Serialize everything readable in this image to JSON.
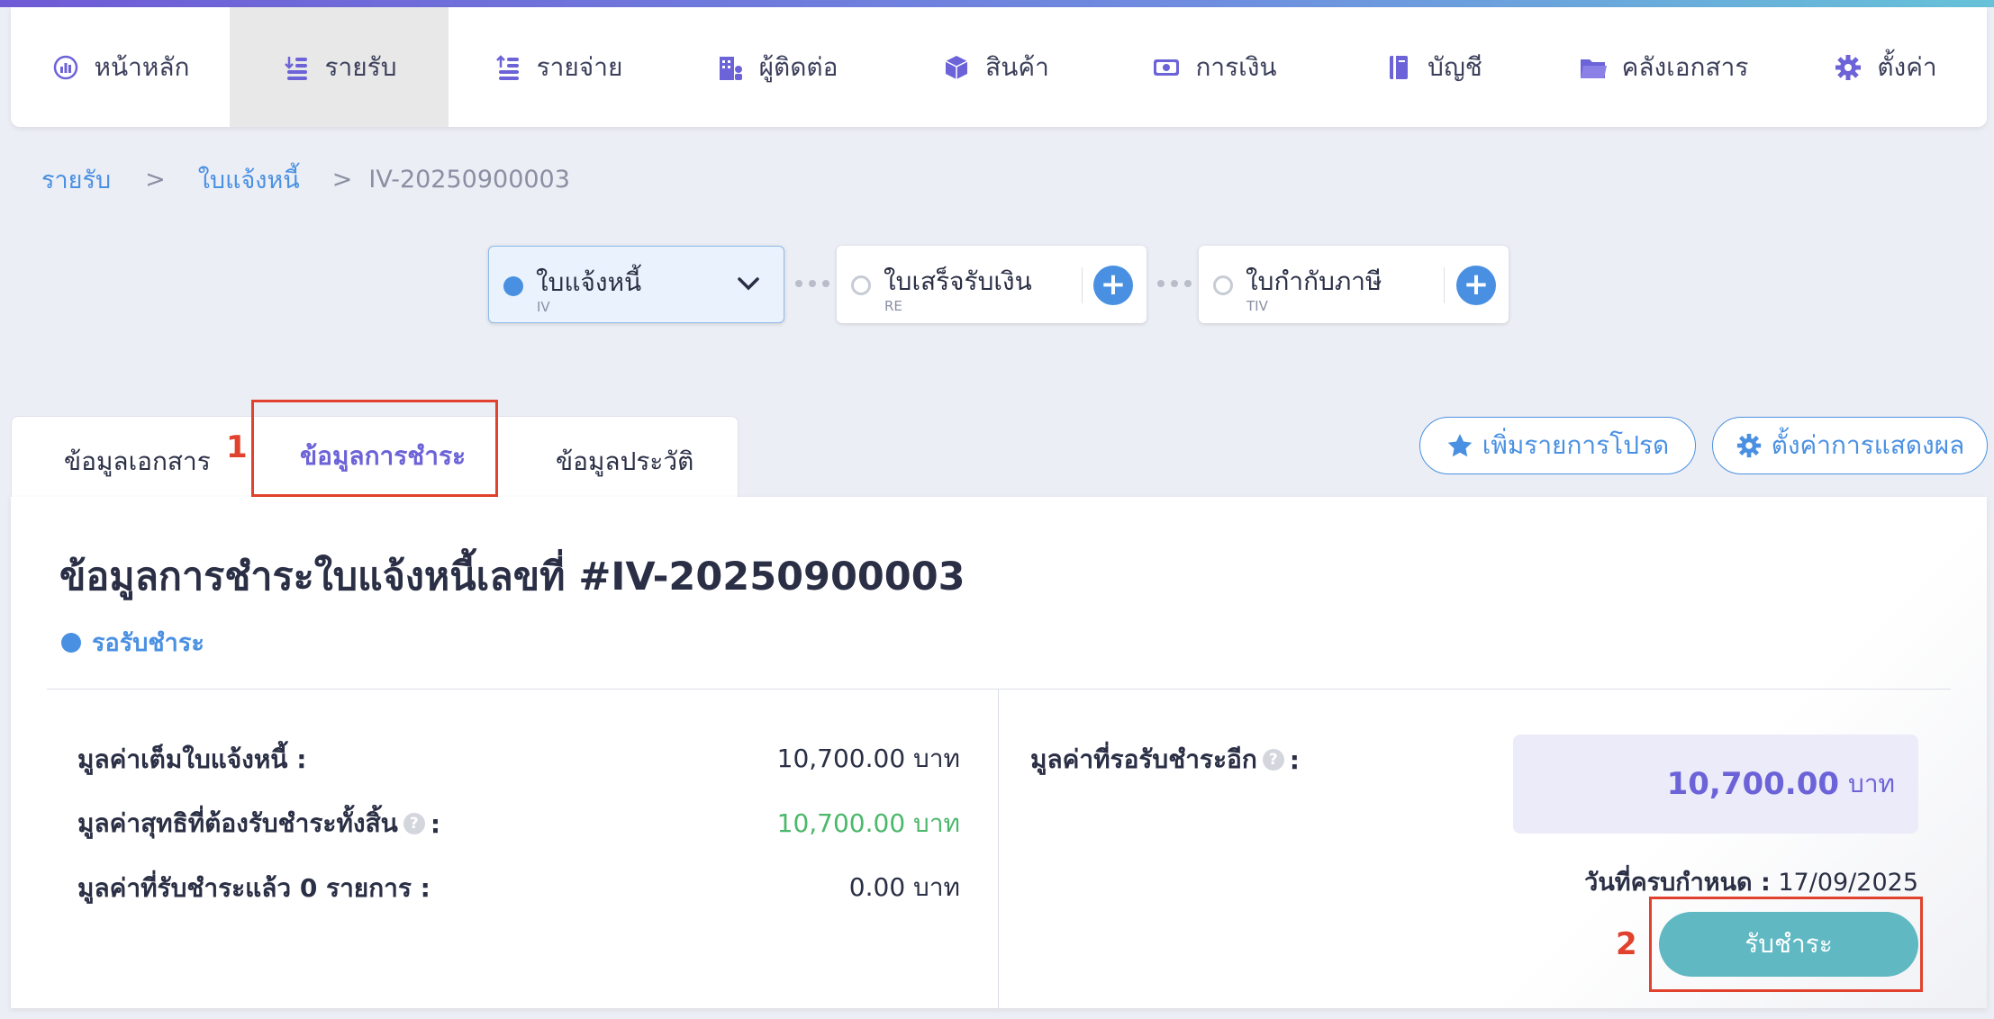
{
  "nav": {
    "items": [
      {
        "label": "หน้าหลัก",
        "icon": "dashboard-gauge-icon"
      },
      {
        "label": "รายรับ",
        "icon": "income-coins-icon"
      },
      {
        "label": "รายจ่าย",
        "icon": "expense-coins-icon"
      },
      {
        "label": "ผู้ติดต่อ",
        "icon": "contacts-building-icon"
      },
      {
        "label": "สินค้า",
        "icon": "product-box-icon"
      },
      {
        "label": "การเงิน",
        "icon": "money-bill-icon"
      },
      {
        "label": "บัญชี",
        "icon": "account-book-icon"
      },
      {
        "label": "คลังเอกสาร",
        "icon": "folder-icon"
      },
      {
        "label": "ตั้งค่า",
        "icon": "gear-icon"
      }
    ],
    "active_index": 1
  },
  "breadcrumb": {
    "level1": "รายรับ",
    "level2": "ใบแจ้งหนี้",
    "current": "IV-20250900003",
    "separator": ">"
  },
  "flow": {
    "steps": [
      {
        "title": "ใบแจ้งหนี้",
        "code": "IV"
      },
      {
        "title": "ใบเสร็จรับเงิน",
        "code": "RE"
      },
      {
        "title": "ใบกำกับภาษี",
        "code": "TIV"
      }
    ],
    "plus": "+"
  },
  "tabs": {
    "items": [
      "ข้อมูลเอกสาร",
      "ข้อมูลการชำระ",
      "ข้อมูลประวัติ"
    ],
    "active_index": 1
  },
  "annotations": {
    "step1": "1",
    "step2": "2"
  },
  "actions": {
    "favorite": "เพิ่มรายการโปรด",
    "display_settings": "ตั้งค่าการแสดงผล"
  },
  "payment": {
    "title": "ข้อมูลการชำระใบแจ้งหนี้เลขที่ #IV-20250900003",
    "status": "รอรับชำระ",
    "full_amount_label": "มูลค่าเต็มใบแจ้งหนี้ :",
    "full_amount_value": "10,700.00 บาท",
    "net_amount_label": "มูลค่าสุทธิที่ต้องรับชำระทั้งสิ้น",
    "net_amount_value": "10,700.00 บาท",
    "paid_label": "มูลค่าที่รับชำระแล้ว 0 รายการ :",
    "paid_value": "0.00 บาท",
    "remaining_label": "มูลค่าที่รอรับชำระอีก",
    "remaining_amount": "10,700.00",
    "remaining_unit": "บาท",
    "due_label": "วันที่ครบกำหนด :",
    "due_date": "17/09/2025",
    "pay_button": "รับชำระ",
    "help_mark": "?",
    "colon": ":"
  },
  "colors": {
    "accent": "#4a90e2",
    "purple": "#6c63d8",
    "green": "#4cb86b",
    "pay_button": "#5fb8c2",
    "highlight": "#e0422d"
  }
}
